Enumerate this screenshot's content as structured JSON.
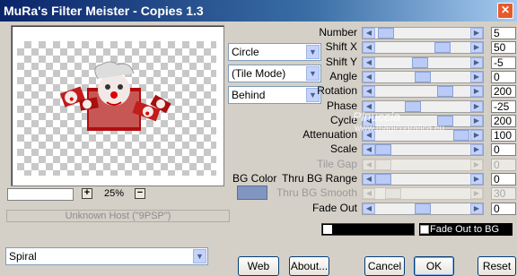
{
  "window": {
    "title": "MuRa's Filter Meister - Copies 1.3"
  },
  "preview": {
    "zoom": "25%",
    "host_status": "Unknown Host (\"9PSP\")"
  },
  "dropdowns": {
    "shape": "Circle",
    "tile_mode": "(Tile Mode)",
    "order": "Behind",
    "pattern": "Spiral"
  },
  "bg_color": {
    "label": "BG Color",
    "swatch": "#8096c0"
  },
  "params": [
    {
      "name": "Number",
      "value": "5",
      "level": 0.03,
      "enabled": true
    },
    {
      "name": "Shift X",
      "value": "50",
      "level": 0.75,
      "enabled": true
    },
    {
      "name": "Shift Y",
      "value": "-5",
      "level": 0.47,
      "enabled": true
    },
    {
      "name": "Angle",
      "value": "0",
      "level": 0.5,
      "enabled": true
    },
    {
      "name": "Rotation",
      "value": "200",
      "level": 0.78,
      "enabled": true
    },
    {
      "name": "Phase",
      "value": "-25",
      "level": 0.38,
      "enabled": true
    },
    {
      "name": "Cycle",
      "value": "200",
      "level": 0.78,
      "enabled": true
    },
    {
      "name": "Attenuation",
      "value": "100",
      "level": 0.99,
      "enabled": true
    },
    {
      "name": "Scale",
      "value": "0",
      "level": 0.0,
      "enabled": true
    },
    {
      "name": "Tile Gap",
      "value": "0",
      "level": 0.0,
      "enabled": false
    },
    {
      "name": "Thru BG Range",
      "value": "0",
      "level": 0.0,
      "enabled": true
    },
    {
      "name": "Thru BG Smooth",
      "value": "30",
      "level": 0.12,
      "enabled": false
    },
    {
      "name": "Fade Out",
      "value": "0",
      "level": 0.5,
      "enabled": true
    }
  ],
  "fade_to_bg_label": "Fade Out to BG",
  "buttons": {
    "web": "Web",
    "about": "About...",
    "cancel": "Cancel",
    "ok": "OK",
    "reset": "Reset"
  },
  "watermark": {
    "line1": "Pinuccia",
    "line2": "www.magicografica.eu"
  }
}
